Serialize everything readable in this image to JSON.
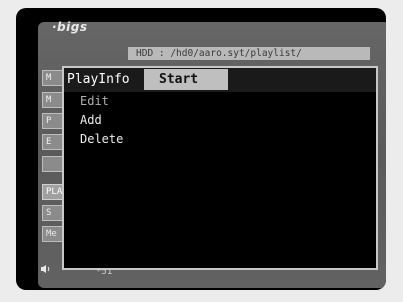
{
  "app": {
    "logo": "·bigs"
  },
  "path": {
    "label": "HDD : /hd0/aaro.syt/playlist/"
  },
  "left_menu": {
    "items": [
      {
        "label": "M",
        "state": "normal"
      },
      {
        "label": "M",
        "state": "normal"
      },
      {
        "label": "P",
        "state": "normal"
      },
      {
        "label": "E",
        "state": "normal"
      },
      {
        "label": "",
        "state": "normal"
      },
      {
        "label": "PLA",
        "state": "selected"
      },
      {
        "label": "S",
        "state": "normal"
      },
      {
        "label": "Me",
        "state": "normal"
      }
    ]
  },
  "statusbar": {
    "speaker_icon": "speaker-icon",
    "time_text": "*51"
  },
  "popup": {
    "title": "PlayInfo",
    "tab_label": "Start",
    "items": [
      {
        "label": "Edit",
        "dim": true
      },
      {
        "label": "Add",
        "dim": false
      },
      {
        "label": "Delete",
        "dim": false
      }
    ]
  },
  "colors": {
    "popup_bg": "#000000",
    "tab_bg": "#bfbfbf",
    "screen_bg": "#5f5f5f"
  }
}
